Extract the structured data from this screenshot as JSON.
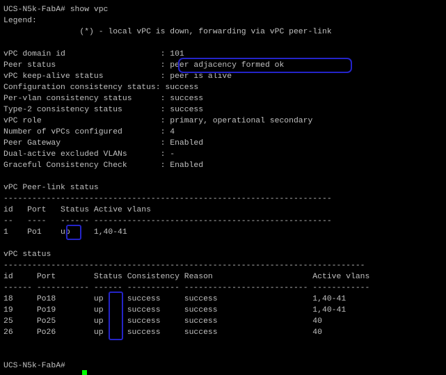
{
  "terminal": {
    "background": "#000000",
    "foreground": "#c0c0c0",
    "highlight_color": "#2424c8",
    "cursor_color": "#00ff00",
    "lines": [
      "UCS-N5k-FabA# show vpc",
      "Legend:",
      "                (*) - local vPC is down, forwarding via vPC peer-link",
      "",
      "vPC domain id                    : 101",
      "Peer status                      : peer adjacency formed ok",
      "vPC keep-alive status            : peer is alive",
      "Configuration consistency status: success",
      "Per-vlan consistency status      : success",
      "Type-2 consistency status        : success",
      "vPC role                         : primary, operational secondary",
      "Number of vPCs configured        : 4",
      "Peer Gateway                     : Enabled",
      "Dual-active excluded VLANs       : -",
      "Graceful Consistency Check       : Enabled",
      "",
      "vPC Peer-link status",
      "---------------------------------------------------------------------",
      "id   Port   Status Active vlans",
      "--   ----   ------ --------------------------------------------------",
      "1    Po1    up     1,40-41",
      "",
      "vPC status",
      "----------------------------------------------------------------------------",
      "id     Port        Status Consistency Reason                     Active vlans",
      "------ ----------- ------ ----------- -------------------------- ------------",
      "18     Po18        up     success     success                    1,40-41",
      "19     Po19        up     success     success                    1,40-41",
      "25     Po25        up     success     success                    40",
      "26     Po26        up     success     success                    40",
      "",
      "",
      "UCS-N5k-FabA#"
    ]
  }
}
